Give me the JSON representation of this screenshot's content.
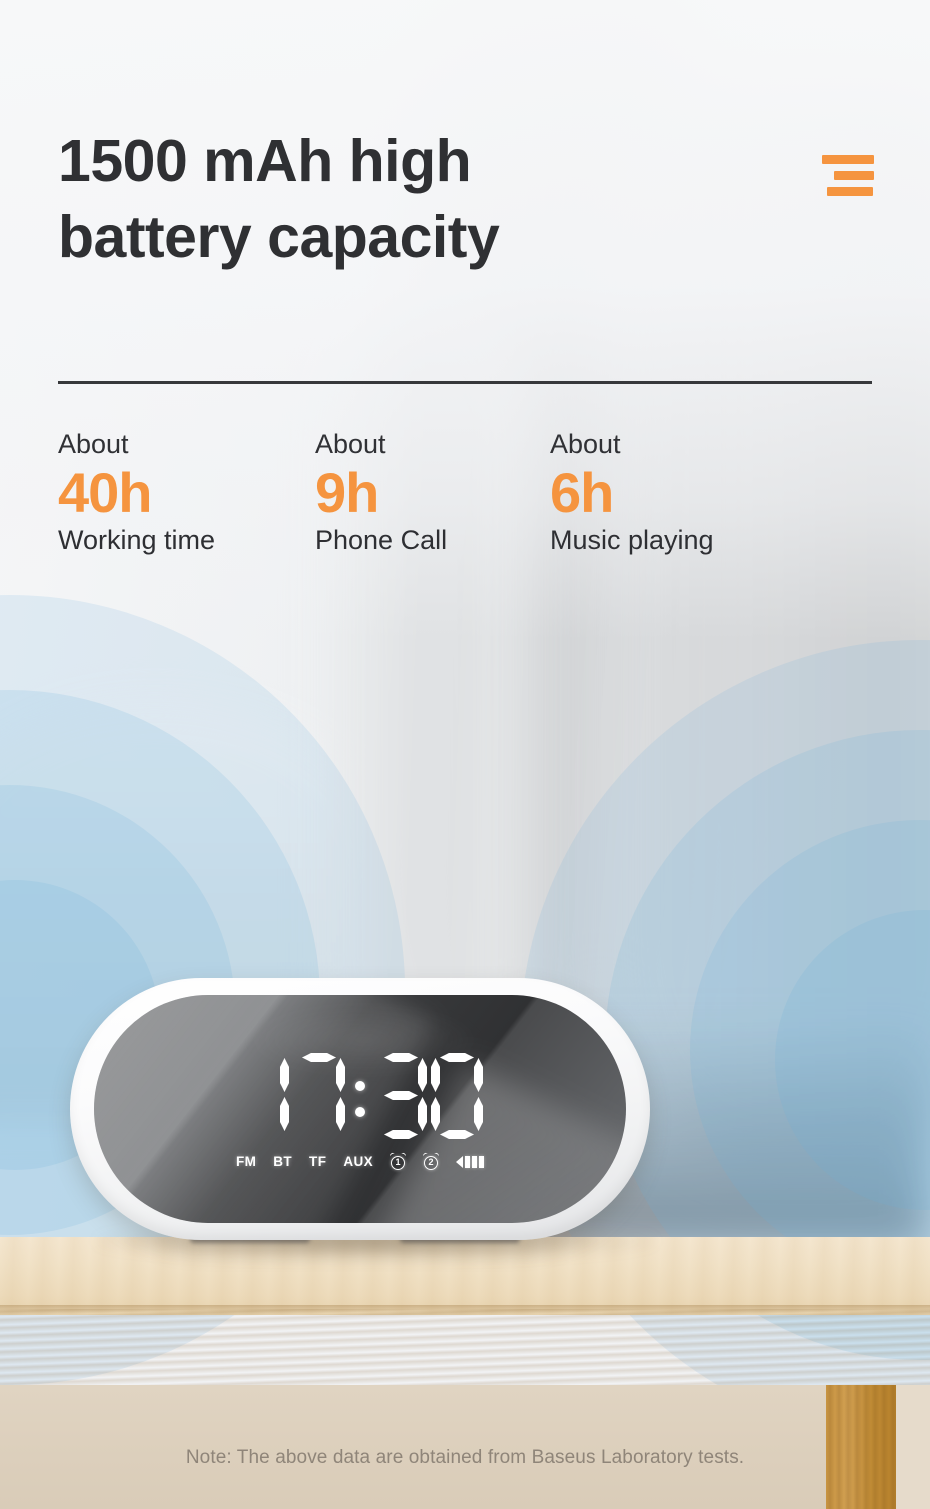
{
  "header": {
    "headline_line1": "1500 mAh high",
    "headline_line2": "battery capacity",
    "menu_icon": "hamburger-menu-icon",
    "accent_color": "#f5943f",
    "text_color": "#2f3033"
  },
  "stats": [
    {
      "about": "About",
      "value": "40h",
      "label": "Working time"
    },
    {
      "about": "About",
      "value": "9h",
      "label": "Phone Call"
    },
    {
      "about": "About",
      "value": "6h",
      "label": "Music playing"
    }
  ],
  "device": {
    "name": "bluetooth-alarm-clock-speaker",
    "time": "17:30",
    "time_digits": [
      "1",
      "7",
      "3",
      "0"
    ],
    "status_indicators": [
      "FM",
      "BT",
      "TF",
      "AUX"
    ],
    "alarm_1_label": "1",
    "alarm_2_label": "2",
    "battery_bars": 3,
    "display_color": "#ffffff",
    "body_color": "#ffffff",
    "face_color": "#3a3b3d"
  },
  "sound_waves": {
    "color": "#6ab0de",
    "ring_count_left": 4,
    "ring_count_right": 4
  },
  "footer": {
    "note": "Note: The above data are obtained from Baseus Laboratory tests."
  }
}
